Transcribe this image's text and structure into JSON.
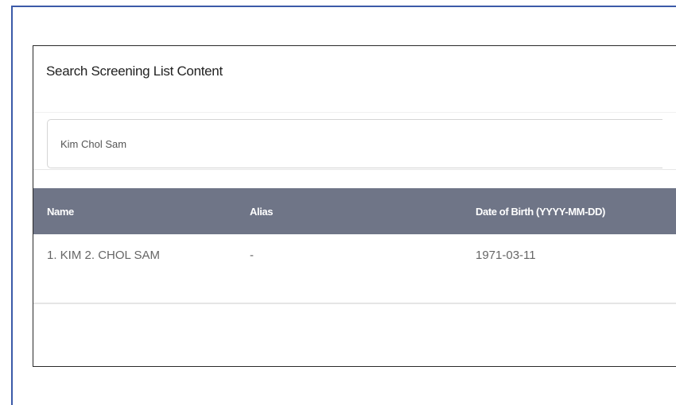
{
  "panel": {
    "title": "Search Screening List Content"
  },
  "search": {
    "value": "Kim Chol Sam",
    "placeholder": ""
  },
  "table": {
    "columns": [
      "Name",
      "Alias",
      "Date of Birth (YYYY-MM-DD)"
    ],
    "rows": [
      {
        "name": "1. KIM 2. CHOL SAM",
        "alias": "-",
        "dob": "1971-03-11"
      }
    ]
  },
  "colors": {
    "frame_border": "#3b5aa8",
    "table_header_bg": "#6f7587",
    "table_header_text": "#ffffff"
  }
}
